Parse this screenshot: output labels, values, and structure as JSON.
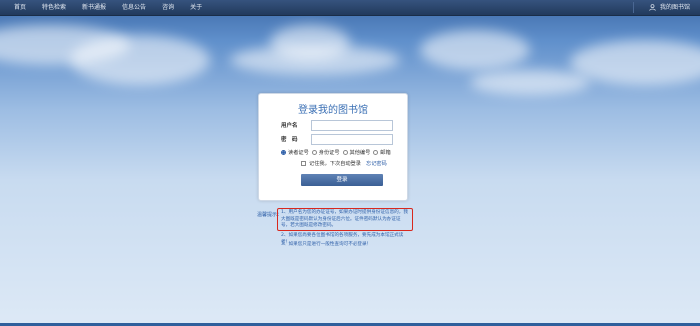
{
  "nav": {
    "items": [
      "首页",
      "特色检索",
      "新书通报",
      "信息公告",
      "咨询",
      "关于"
    ]
  },
  "header": {
    "my_library": "我的图书馆"
  },
  "login": {
    "title": "登录我的图书馆",
    "username_label": "用户名",
    "password_label": "密　码",
    "username_value": "",
    "password_value": "",
    "id_types": [
      "读者证号",
      "身份证号",
      "其他编号",
      "邮箱"
    ],
    "selected_id_type": "读者证号",
    "remember_label": "记住我，下次自动登录",
    "forgot_label": "忘记密码",
    "submit_label": "登录"
  },
  "tips": {
    "label": "温馨提示：",
    "items": [
      "1、用户名为您的办证证号，如果办证时提供身份证信息的，我大图既是密码默认为身份证后六位。证件密码默认为办证证号，若大图既是修改密码。",
      "2、如果您尚要各位图书馆的各项服务，要先成为本馆正式读者！",
      "3、如果您只是进行一般性查询可不必登录！"
    ]
  },
  "colors": {
    "nav_bg": "#223a5c",
    "accent": "#3a6fb4",
    "button": "#3a5f95",
    "highlight_box": "#d8281e"
  }
}
